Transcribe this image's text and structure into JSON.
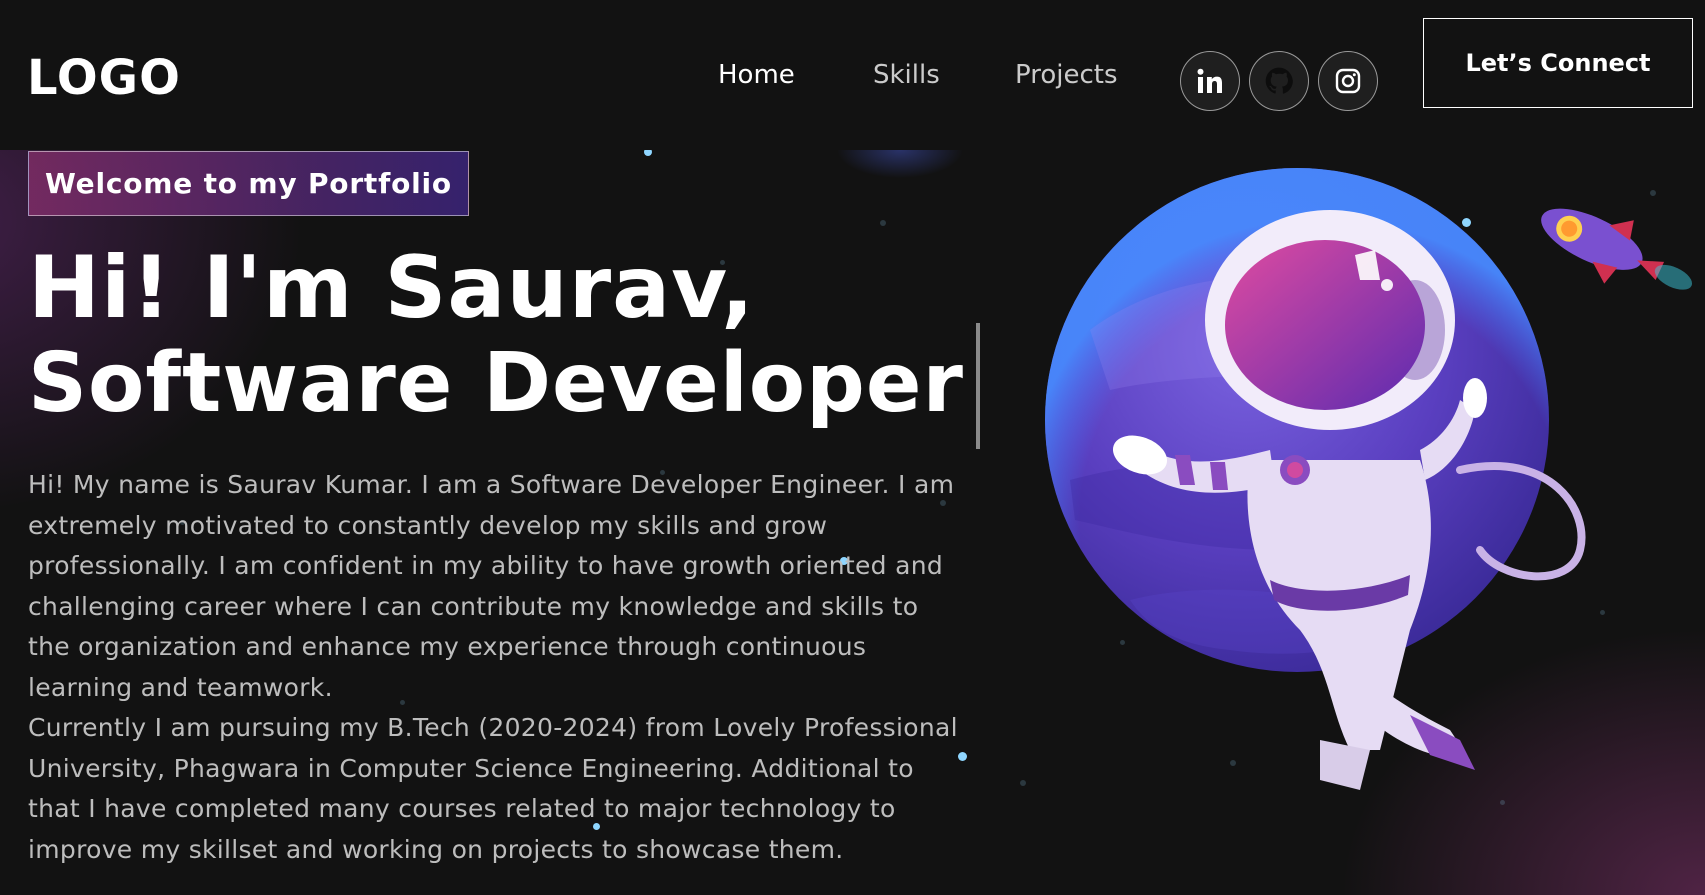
{
  "nav": {
    "logo": "LOGO",
    "links": [
      "Home",
      "Skills",
      "Projects"
    ],
    "social": [
      {
        "name": "linkedin-icon",
        "glyph": "in"
      },
      {
        "name": "github-icon",
        "glyph": ""
      },
      {
        "name": "instagram-icon",
        "glyph": ""
      }
    ],
    "cta": "Let’s Connect"
  },
  "hero": {
    "tagline": "Welcome to my Portfolio",
    "headline_line1": "Hi! I'm Saurav,",
    "headline_line2": "Software Developer",
    "bio_p1": "Hi! My name is Saurav Kumar. I am a Software Developer Engineer. I am extremely motivated to constantly develop my skills and grow professionally. I am confident in my ability to have growth oriented and challenging career where I can contribute my knowledge and skills to the organization and enhance my experience through continuous learning and teamwork.",
    "bio_p2": "Currently I am pursuing my B.Tech (2020-2024) from Lovely Professional University, Phagwara in Computer Science Engineering. Additional to that I have completed many courses related to major technology to improve my skillset and working on projects to showcase them."
  },
  "theme": {
    "background": "#121212",
    "text": "#ffffff",
    "muted_text": "#bdbdbd",
    "gradient_start": "#aa367c",
    "gradient_end": "#4a2fbd"
  }
}
